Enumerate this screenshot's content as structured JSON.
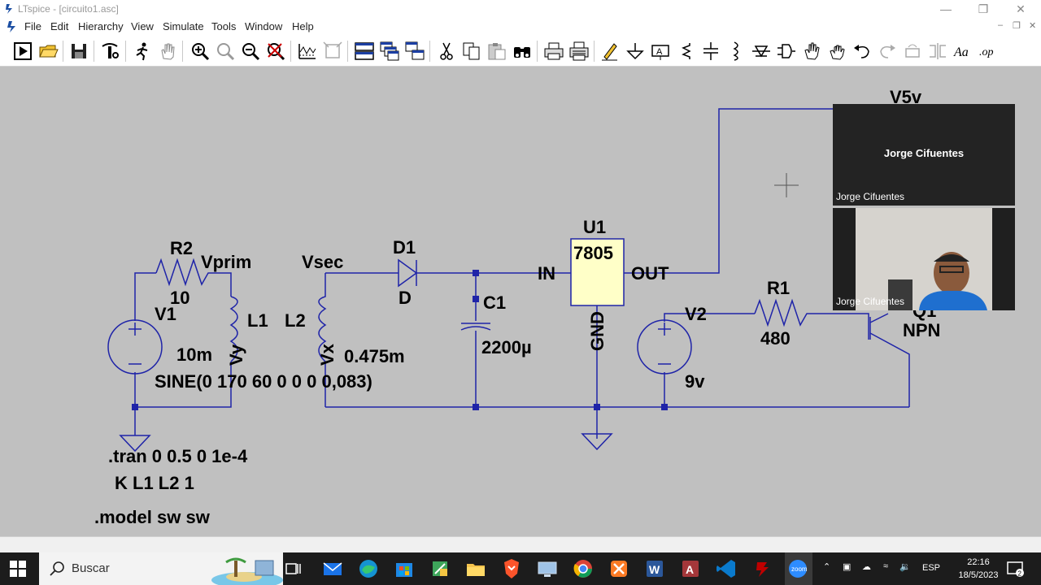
{
  "window": {
    "title": "LTspice - [circuito1.asc]"
  },
  "menu": [
    "File",
    "Edit",
    "Hierarchy",
    "View",
    "Simulate",
    "Tools",
    "Window",
    "Help"
  ],
  "toolbar_icons": [
    "run-icon",
    "open-icon",
    "save-icon",
    "control-panel-icon",
    "halt-icon",
    "pan-icon",
    "zoom-in-icon",
    "zoom-area-icon",
    "zoom-out-icon",
    "zoom-cancel-icon",
    "waveform-icon",
    "autorange-icon",
    "tile-horizontal-icon",
    "cascade-icon",
    "tile-vertical-icon",
    "cut-icon",
    "copy-icon",
    "paste-icon",
    "find-icon",
    "print-icon",
    "print-setup-icon",
    "draw-wire-icon",
    "ground-icon",
    "label-net-icon",
    "resistor-icon",
    "capacitor-icon",
    "inductor-icon",
    "diode-icon",
    "component-icon",
    "move-icon",
    "drag-icon",
    "undo-icon",
    "redo-icon",
    "rotate-icon",
    "mirror-icon",
    "text-icon",
    "spice-directive-icon"
  ],
  "schematic": {
    "labels": {
      "r2": "R2",
      "r2_value": "10",
      "vprim": "Vprim",
      "v1": "V1",
      "l1": "L1",
      "l1_value": "10m",
      "vy": "Vy",
      "sine": "SINE(0 170 60 0 0 0 0,083)",
      "vsec": "Vsec",
      "l2": "L2",
      "vx": "Vx",
      "l2_value": "0.475m",
      "d1": "D1",
      "d_model": "D",
      "c1": "C1",
      "c1_value": "2200µ",
      "u1": "U1",
      "reg": "7805",
      "in": "IN",
      "out": "OUT",
      "gnd": "GND",
      "v5v": "V5v",
      "v2": "V2",
      "v2_value": "9v",
      "r1": "R1",
      "r1_value": "480",
      "q1": "Q1",
      "npn": "NPN"
    },
    "directives": [
      ".tran 0 0.5 0 1e-4",
      "K L1 L2 1",
      ".model sw sw"
    ]
  },
  "zoom": {
    "participant_name": "Jorge Cifuentes",
    "tile_name_top": "Jorge Cifuentes",
    "tile_name_bottom": "Jorge Cifuentes"
  },
  "taskbar": {
    "search_placeholder": "Buscar",
    "apps": [
      "task-view-icon",
      "mail-icon",
      "edge-icon",
      "store-icon",
      "snip-icon",
      "explorer-icon",
      "brave-icon",
      "pc-icon",
      "chrome-icon",
      "xampp-icon",
      "word-icon",
      "access-icon",
      "vscode-icon",
      "filezilla-icon",
      "zoom-icon"
    ],
    "language": "ESP",
    "time": "22:16",
    "date": "18/5/2023",
    "notifications": "2"
  }
}
